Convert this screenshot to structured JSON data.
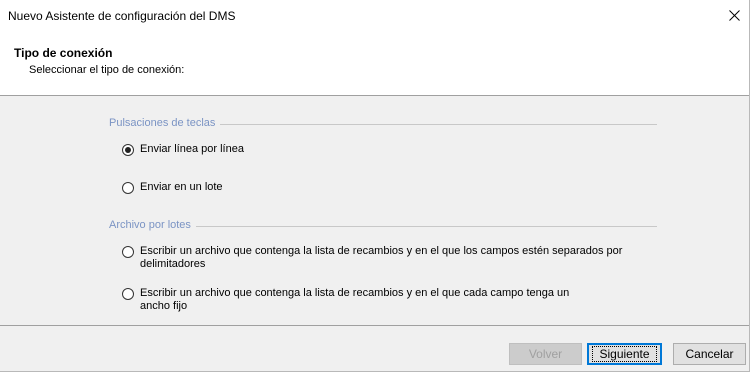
{
  "window": {
    "title": "Nuevo Asistente de configuración del DMS",
    "close_glyph": "✕"
  },
  "header": {
    "title": "Tipo de conexión",
    "subtitle": "Seleccionar el tipo de conexión:"
  },
  "groups": [
    {
      "label": "Pulsaciones de teclas",
      "options": [
        {
          "label": "Enviar línea por línea",
          "selected": true
        },
        {
          "label": "Enviar en un lote",
          "selected": false
        }
      ]
    },
    {
      "label": "Archivo por lotes",
      "options": [
        {
          "label": "Escribir un archivo que contenga la lista de recambios y en el que los campos estén separados por delimitadores",
          "selected": false
        },
        {
          "label": "Escribir un archivo que contenga la lista de recambios y en el que cada campo tenga un ancho fijo",
          "selected": false
        }
      ]
    }
  ],
  "buttons": {
    "back": "Volver",
    "next": "Siguiente",
    "cancel": "Cancelar"
  },
  "colors": {
    "group_label": "#7b94c4",
    "default_button_border": "#0078d7"
  }
}
